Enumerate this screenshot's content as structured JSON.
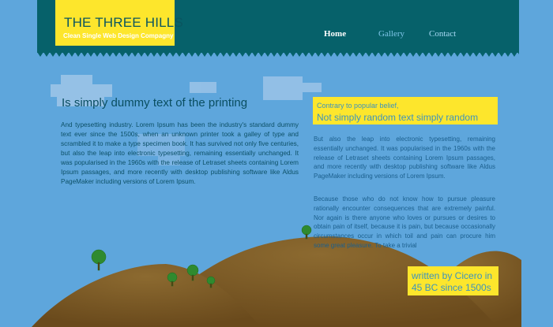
{
  "header": {
    "logo_title": "THE THREE HILLS",
    "logo_subtitle": "Clean Single Web Design Compagny"
  },
  "nav": {
    "home": "Home",
    "gallery": "Gallery",
    "contact": "Contact"
  },
  "left": {
    "heading": "Is simply dummy text of the printing",
    "body": "And typesetting industry. Lorem Ipsum has been the industry's standard dummy text ever since the 1500s, when an unknown printer took a galley of type and scrambled it to make a type specimen book. It has survived not only five centuries, but also the  leap into electronic typesetting, remaining essentially unchanged. It was popularised in the 1960s with the release of Letraset sheets containing Lorem Ipsum passages, and more recently with desktop publishing software like Aldus PageMaker including versions of Lorem Ipsum."
  },
  "right": {
    "box_small": "Contrary to popular belief,",
    "box_big": "Not simply random text simply random",
    "p1": "But also the  leap into electronic typesetting, remaining essentially unchanged. It was popularised in the 1960s with the release of Letraset sheets containing Lorem Ipsum passages, and more recently with desktop publishing software like Aldus PageMaker including versions of Lorem Ipsum.",
    "p2": "Because those who do not know how to pursue pleasure rationally encounter consequences that are extremely painful. Nor again is there anyone who loves or pursues or desires to obtain pain of itself, because it is pain, but because occasionally circumstances occur in which toil and pain can procure him some great pleasure. To take a trivial"
  },
  "cicero": {
    "line1": "written by Cicero in",
    "line2": "45 BC since 1500s"
  },
  "colors": {
    "sky": "#5ea6dc",
    "header": "#06616a",
    "accent_yellow": "#fde62c",
    "hill_brown": "#7a5a26",
    "tree_green": "#2f8a2f"
  }
}
